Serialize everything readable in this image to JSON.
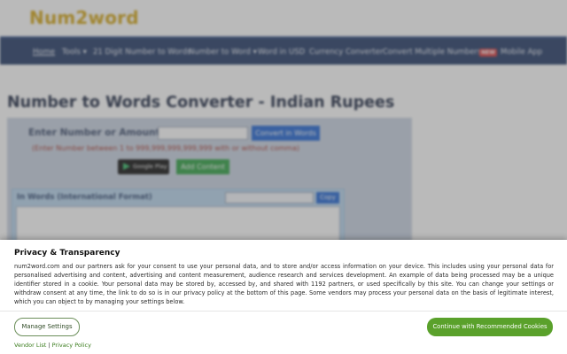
{
  "site": {
    "logo": "Num2word"
  },
  "nav": {
    "items": [
      {
        "label": "Home",
        "active": true
      },
      {
        "label": "Tools",
        "dropdown": true
      },
      {
        "label": "21 Digit Number to Words"
      },
      {
        "label": "Number to Word",
        "dropdown": true
      },
      {
        "label": "Word in USD"
      },
      {
        "label": "Currency Converter"
      },
      {
        "label": "Convert Multiple Numbers"
      },
      {
        "label": "Mobile App",
        "badge": "NEW"
      }
    ]
  },
  "main": {
    "title": "Number to Words Converter - Indian Rupees",
    "enter_label": "Enter Number or Amount",
    "amount_value": "",
    "convert_button": "Convert in Words",
    "hint": "(Enter Number between 1 to 999,999,999,999,999 with or without comma)",
    "google_play": "Google Play",
    "add_button": "Add Content",
    "words_label": "In Words (International Format)",
    "copy_button": "Copy",
    "words_output": ""
  },
  "consent": {
    "title": "Privacy & Transparency",
    "body": "num2word.com and our partners ask for your consent to use your personal data, and to store and/or access information on your device. This includes using your personal data for personalised advertising and content, advertising and content measurement, audience research and services development. An example of data being processed may be a unique identifier stored in a cookie. Your personal data may be stored by, accessed by, and shared with 1192 partners, or used specifically by this site. You can change your settings or withdraw consent at any time, the link to do so is in our privacy policy at the bottom of this page. Some vendors may process your personal data on the basis of legitimate interest, which you can object to by managing your settings below.",
    "manage_button": "Manage Settings",
    "accept_button": "Continue with Recommended Cookies",
    "vendor_link": "Vendor List",
    "separator": "|",
    "privacy_link": "Privacy Policy"
  },
  "colors": {
    "logo": "#d4a514",
    "navbar": "#233a66",
    "accept": "#5aa12b",
    "link": "#3b7d1e"
  }
}
